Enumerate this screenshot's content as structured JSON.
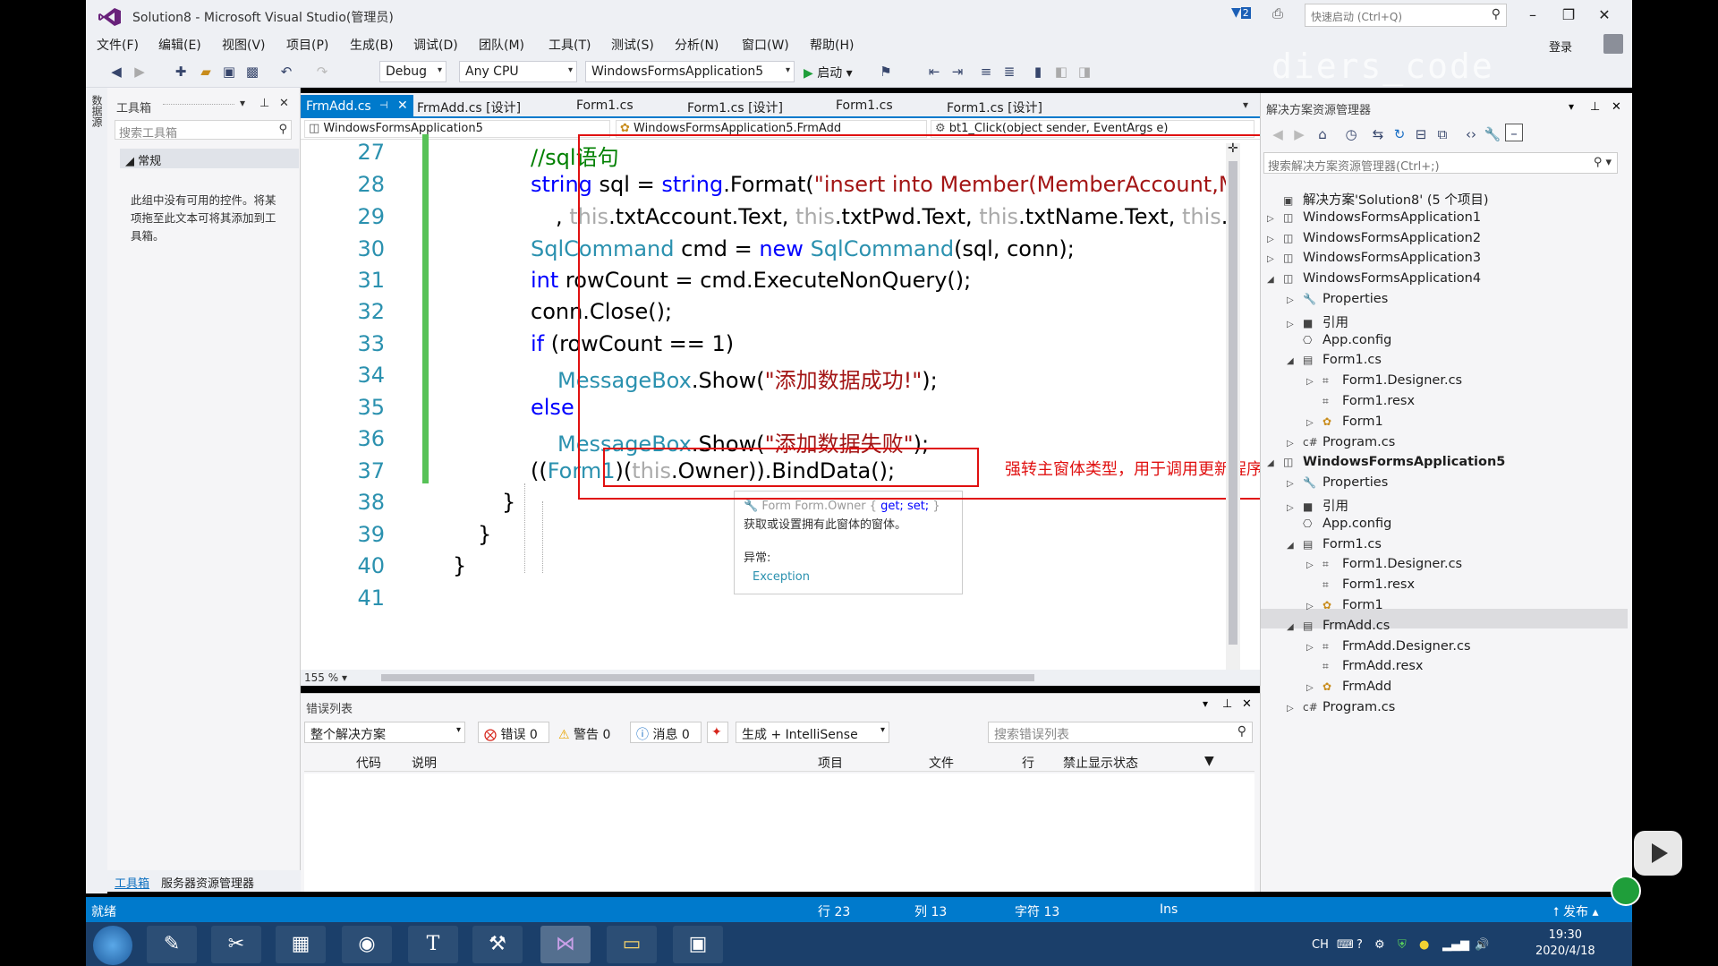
{
  "window": {
    "title": "Solution8 - Microsoft Visual Studio(管理员)",
    "notif_count": "2",
    "quick_launch": "快速启动 (Ctrl+Q)",
    "login": "登录",
    "watermark": "diers_code"
  },
  "menu": [
    "文件(F)",
    "编辑(E)",
    "视图(V)",
    "项目(P)",
    "生成(B)",
    "调试(D)",
    "团队(M)",
    "工具(T)",
    "测试(S)",
    "分析(N)",
    "窗口(W)",
    "帮助(H)"
  ],
  "toolbar": {
    "config": "Debug",
    "platform": "Any CPU",
    "startup": "WindowsFormsApplication5",
    "start": "启动"
  },
  "toolbox": {
    "title": "工具箱",
    "search": "搜索工具箱",
    "group": "常规",
    "empty": "此组中没有可用的控件。将某项拖至此文本可将其添加到工具箱。",
    "tab1": "工具箱",
    "tab2": "服务器资源管理器",
    "side_tab": "数据源"
  },
  "tabs": {
    "active": "FrmAdd.cs",
    "others": [
      "FrmAdd.cs [设计]",
      "Form1.cs",
      "Form1.cs [设计]",
      "Form1.cs",
      "Form1.cs [设计]"
    ]
  },
  "nav": {
    "project": "WindowsFormsApplication5",
    "class": "WindowsFormsApplication5.FrmAdd",
    "member": "bt1_Click(object sender, EventArgs e)"
  },
  "code": {
    "lines": [
      "27",
      "28",
      "29",
      "30",
      "31",
      "32",
      "33",
      "34",
      "35",
      "36",
      "37",
      "38",
      "39",
      "40",
      "41"
    ],
    "l27": "//sql语句",
    "l28a": "string",
    "l28b": " sql = ",
    "l28c": "string",
    "l28d": ".Format(",
    "l28e": "\"insert into Member(MemberAccount,Mem",
    "l29a": ", ",
    "l29b": "this",
    "l29c": ".txtAccount.Text, ",
    "l29d": "this",
    "l29e": ".txtPwd.Text, ",
    "l29f": "this",
    "l29g": ".txtName.Text, ",
    "l29h": "this",
    "l29i": ".txtP",
    "l30a": "SqlCommand",
    "l30b": " cmd = ",
    "l30c": "new",
    "l30d": " ",
    "l30e": "SqlCommand",
    "l30f": "(sql, conn);",
    "l31a": "int",
    "l31b": " rowCount = cmd.ExecuteNonQuery();",
    "l32": "conn.Close();",
    "l33a": "if",
    "l33b": " (rowCount == 1)",
    "l34a": "MessageBox",
    "l34b": ".Show(",
    "l34c": "\"添加数据成功!\"",
    "l34d": ");",
    "l35": "else",
    "l36a": "MessageBox",
    "l36b": ".Show(",
    "l36c": "\"添加数据失败\"",
    "l36d": ");",
    "l37a": "((",
    "l37b": "Form1",
    "l37c": ")(",
    "l37d": "this",
    "l37e": ".Owner)).BindData();",
    "l38": "}",
    "l39": "}",
    "l40": "}"
  },
  "annotation": "强转主窗体类型，用于调用更新程序",
  "tooltip": {
    "sig1": "Form Form.Owner { ",
    "get": "get; set;",
    "sig2": " }",
    "desc": "获取或设置拥有此窗体的窗体。",
    "exc_label": "异常:",
    "exc": "Exception"
  },
  "zoom": "155 %",
  "errors": {
    "title": "错误列表",
    "scope": "整个解决方案",
    "errors": "错误 0",
    "warnings": "警告 0",
    "messages": "消息 0",
    "build": "生成 + IntelliSense",
    "search": "搜索错误列表",
    "cols": [
      "代码",
      "说明",
      "项目",
      "文件",
      "行",
      "禁止显示状态"
    ]
  },
  "solution": {
    "title": "解决方案资源管理器",
    "search": "搜索解决方案资源管理器(Ctrl+;)",
    "items": [
      {
        "t": "解决方案'Solution8' (5 个项目)",
        "lvl": 0,
        "ic": "▣",
        "ex": ""
      },
      {
        "t": "WindowsFormsApplication1",
        "lvl": 0,
        "ic": "◫",
        "ex": "▷"
      },
      {
        "t": "WindowsFormsApplication2",
        "lvl": 0,
        "ic": "◫",
        "ex": "▷"
      },
      {
        "t": "WindowsFormsApplication3",
        "lvl": 0,
        "ic": "◫",
        "ex": "▷"
      },
      {
        "t": "WindowsFormsApplication4",
        "lvl": 0,
        "ic": "◫",
        "ex": "◢"
      },
      {
        "t": "Properties",
        "lvl": 1,
        "ic": "🔧",
        "ex": "▷"
      },
      {
        "t": "引用",
        "lvl": 1,
        "ic": "■",
        "ex": "▷"
      },
      {
        "t": "App.config",
        "lvl": 1,
        "ic": "⎔",
        "ex": ""
      },
      {
        "t": "Form1.cs",
        "lvl": 1,
        "ic": "▤",
        "ex": "◢"
      },
      {
        "t": "Form1.Designer.cs",
        "lvl": 2,
        "ic": "⌗",
        "ex": "▷"
      },
      {
        "t": "Form1.resx",
        "lvl": 2,
        "ic": "⌗",
        "ex": ""
      },
      {
        "t": "Form1",
        "lvl": 2,
        "ic": "✿",
        "ex": "▷"
      },
      {
        "t": "Program.cs",
        "lvl": 1,
        "ic": "c#",
        "ex": "▷"
      },
      {
        "t": "WindowsFormsApplication5",
        "lvl": 0,
        "ic": "◫",
        "ex": "◢",
        "bold": true
      },
      {
        "t": "Properties",
        "lvl": 1,
        "ic": "🔧",
        "ex": "▷"
      },
      {
        "t": "引用",
        "lvl": 1,
        "ic": "■",
        "ex": "▷"
      },
      {
        "t": "App.config",
        "lvl": 1,
        "ic": "⎔",
        "ex": ""
      },
      {
        "t": "Form1.cs",
        "lvl": 1,
        "ic": "▤",
        "ex": "◢"
      },
      {
        "t": "Form1.Designer.cs",
        "lvl": 2,
        "ic": "⌗",
        "ex": "▷"
      },
      {
        "t": "Form1.resx",
        "lvl": 2,
        "ic": "⌗",
        "ex": ""
      },
      {
        "t": "Form1",
        "lvl": 2,
        "ic": "✿",
        "ex": "▷"
      },
      {
        "t": "FrmAdd.cs",
        "lvl": 1,
        "ic": "▤",
        "ex": "◢"
      },
      {
        "t": "FrmAdd.Designer.cs",
        "lvl": 2,
        "ic": "⌗",
        "ex": "▷"
      },
      {
        "t": "FrmAdd.resx",
        "lvl": 2,
        "ic": "⌗",
        "ex": ""
      },
      {
        "t": "FrmAdd",
        "lvl": 2,
        "ic": "✿",
        "ex": "▷"
      },
      {
        "t": "Program.cs",
        "lvl": 1,
        "ic": "c#",
        "ex": "▷"
      }
    ]
  },
  "status": {
    "ready": "就绪",
    "line": "行 23",
    "col": "列 13",
    "char": "字符 13",
    "ins": "Ins",
    "publish": "发布"
  },
  "clock": {
    "time": "19:30",
    "date": "2020/4/18"
  },
  "tray": {
    "lang": "CH"
  },
  "colors": {
    "accent": "#007acc",
    "annot": "#e01010",
    "taskbar": "#1b3f6a"
  }
}
